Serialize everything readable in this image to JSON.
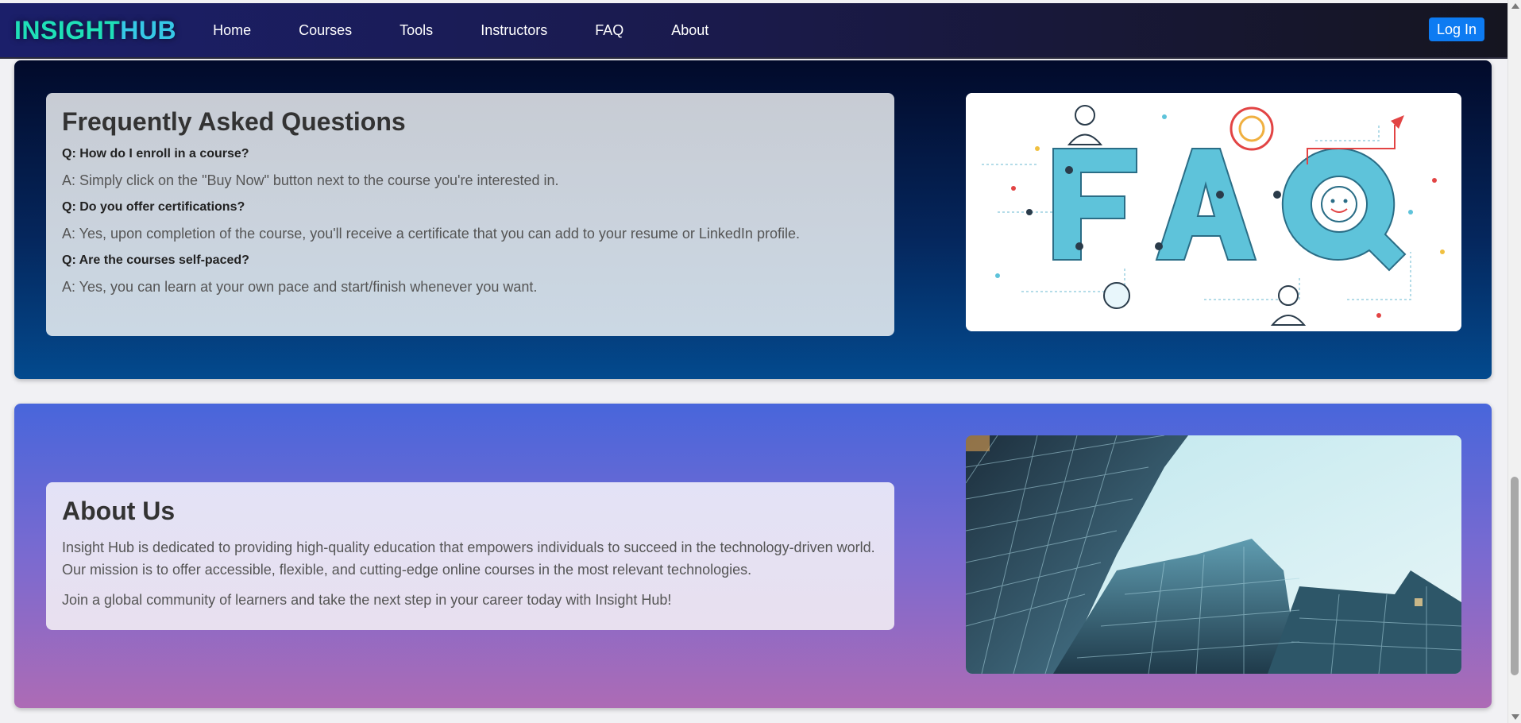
{
  "nav": {
    "logo_part1": "INSIGHT",
    "logo_part2": "HUB",
    "links": [
      "Home",
      "Courses",
      "Tools",
      "Instructors",
      "FAQ",
      "About"
    ],
    "login_label": "Log In"
  },
  "faq": {
    "title": "Frequently Asked Questions",
    "items": [
      {
        "q": "Q: How do I enroll in a course?",
        "a": "A: Simply click on the \"Buy Now\" button next to the course you're interested in."
      },
      {
        "q": "Q: Do you offer certifications?",
        "a": "A: Yes, upon completion of the course, you'll receive a certificate that you can add to your resume or LinkedIn profile."
      },
      {
        "q": "Q: Are the courses self-paced?",
        "a": "A: Yes, you can learn at your own pace and start/finish whenever you want."
      }
    ],
    "image_text": "FAQ"
  },
  "about": {
    "title": "About Us",
    "paragraph1": "Insight Hub is dedicated to providing high-quality education that empowers individuals to succeed in the technology-driven world. Our mission is to offer accessible, flexible, and cutting-edge online courses in the most relevant technologies.",
    "paragraph2": "Join a global community of learners and take the next step in your career today with Insight Hub!"
  },
  "colors": {
    "accent_teal": "#1fe0b8",
    "login_blue": "#0d7bf2",
    "faq_bg": "#05265c",
    "about_bg": "#7a6ad0"
  }
}
